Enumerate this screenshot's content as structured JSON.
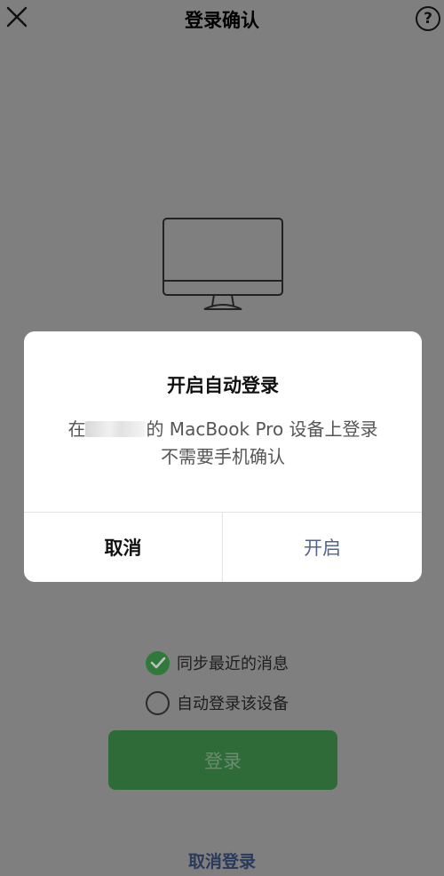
{
  "header": {
    "title": "登录确认",
    "help": "?"
  },
  "options": [
    {
      "label": "同步最近的消息",
      "checked": true
    },
    {
      "label": "自动登录该设备",
      "checked": false
    }
  ],
  "login_button": "登录",
  "cancel_login": "取消登录",
  "dialog": {
    "title": "开启自动登录",
    "message_prefix": "在",
    "message_suffix": "的 MacBook Pro 设备上登录不需要手机确认",
    "cancel": "取消",
    "confirm": "开启"
  },
  "colors": {
    "accent_green": "#2f6b38",
    "link_blue": "#55648a"
  }
}
